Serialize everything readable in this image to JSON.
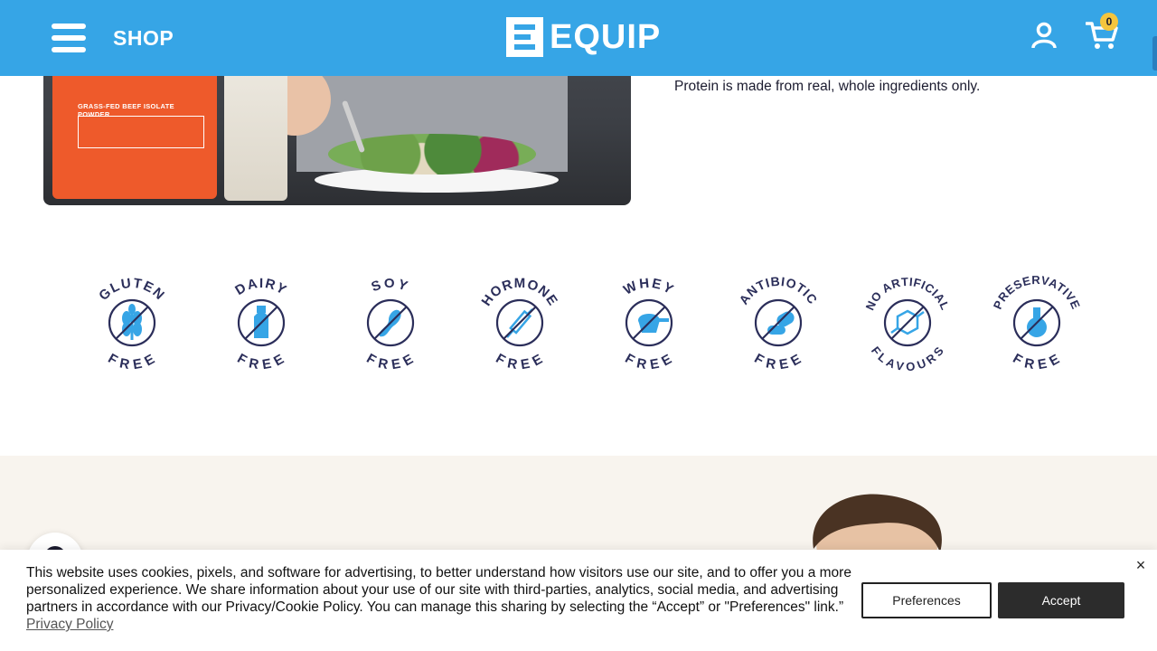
{
  "header": {
    "shop_label": "SHOP",
    "logo_text": "EQUIP",
    "cart_count": "0",
    "menu_icon": "hamburger-menu-icon",
    "account_icon": "user-icon",
    "cart_icon": "shopping-cart-icon"
  },
  "intro": {
    "text": "Protein is made from real, whole ingredients only."
  },
  "product_image": {
    "pouch_title": "GRASS-FED BEEF ISOLATE POWDER"
  },
  "badges": [
    {
      "top": "GLUTEN",
      "bottom": "FREE",
      "icon": "wheat-icon"
    },
    {
      "top": "DAIRY",
      "bottom": "FREE",
      "icon": "milk-bottle-icon"
    },
    {
      "top": "SOY",
      "bottom": "FREE",
      "icon": "soybean-icon"
    },
    {
      "top": "HORMONE",
      "bottom": "FREE",
      "icon": "syringe-icon"
    },
    {
      "top": "WHEY",
      "bottom": "FREE",
      "icon": "whey-scoop-icon"
    },
    {
      "top": "ANTIBIOTIC",
      "bottom": "FREE",
      "icon": "pill-icon"
    },
    {
      "top": "NO ARTIFICIAL",
      "bottom": "FLAVOURS",
      "icon": "molecule-icon"
    },
    {
      "top": "PRESERVATIVE",
      "bottom": "FREE",
      "icon": "flask-icon"
    }
  ],
  "cookie_banner": {
    "text": "This website uses cookies, pixels, and software for advertising, to better understand how visitors use our site, and to offer you a more personalized experience. We share information about your use of our site with third-parties, analytics, social media, and advertising partners in accordance with our Privacy/Cookie Policy. You can manage this sharing by selecting the “Accept” or \"Preferences\" link.” ",
    "link_label": "Privacy Policy",
    "preferences_label": "Preferences",
    "accept_label": "Accept",
    "close_label": "×"
  },
  "colors": {
    "brand_blue": "#36a5e6",
    "icon_blue": "#36a5e6",
    "navy": "#2b2e5a",
    "cart_badge": "#f5c53e",
    "lower_bg": "#f8f4ee"
  }
}
